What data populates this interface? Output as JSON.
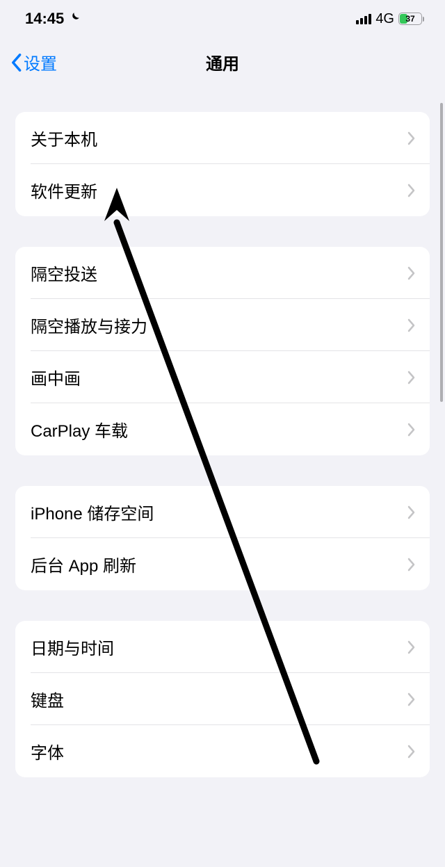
{
  "status": {
    "time": "14:45",
    "network_type": "4G",
    "battery_percent": "37"
  },
  "nav": {
    "back_label": "设置",
    "title": "通用"
  },
  "sections": [
    {
      "rows": [
        {
          "label": "关于本机"
        },
        {
          "label": "软件更新"
        }
      ]
    },
    {
      "rows": [
        {
          "label": "隔空投送"
        },
        {
          "label": "隔空播放与接力"
        },
        {
          "label": "画中画"
        },
        {
          "label": "CarPlay 车载"
        }
      ]
    },
    {
      "rows": [
        {
          "label": "iPhone 储存空间"
        },
        {
          "label": "后台 App 刷新"
        }
      ]
    },
    {
      "rows": [
        {
          "label": "日期与时间"
        },
        {
          "label": "键盘"
        },
        {
          "label": "字体"
        }
      ]
    }
  ]
}
